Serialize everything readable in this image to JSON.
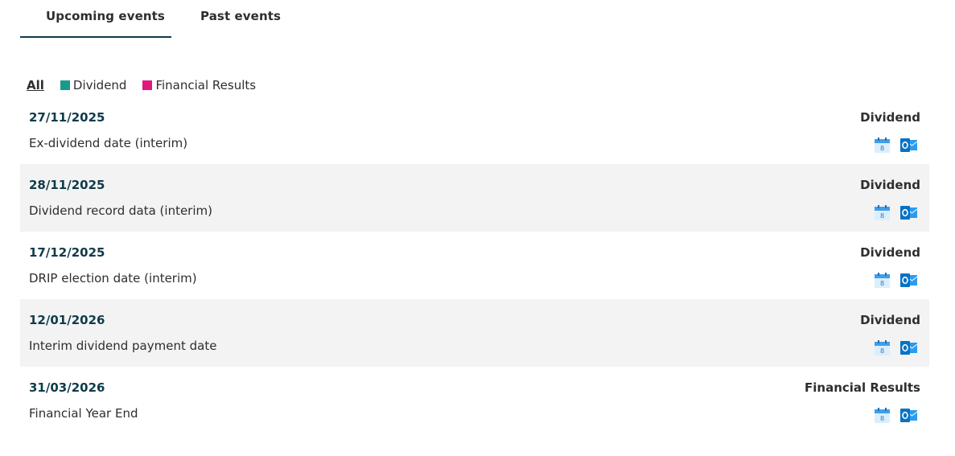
{
  "tabs": {
    "upcoming": "Upcoming events",
    "past": "Past events"
  },
  "filters": {
    "all": "All",
    "items": [
      {
        "label": "Dividend",
        "color": "#1a9a8a"
      },
      {
        "label": "Financial Results",
        "color": "#e0197d"
      }
    ]
  },
  "events": [
    {
      "date": "27/11/2025",
      "title": "Ex-dividend date (interim)",
      "category": "Dividend"
    },
    {
      "date": "28/11/2025",
      "title": "Dividend record data (interim)",
      "category": "Dividend"
    },
    {
      "date": "17/12/2025",
      "title": "DRIP election date (interim)",
      "category": "Dividend"
    },
    {
      "date": "12/01/2026",
      "title": "Interim dividend payment date",
      "category": "Dividend"
    },
    {
      "date": "31/03/2026",
      "title": "Financial Year End",
      "category": "Financial Results"
    }
  ],
  "icons": {
    "calendar": "ical-calendar-icon",
    "outlook": "outlook-icon"
  },
  "colors": {
    "accent": "#0f3b4a",
    "row_shade": "#f3f3f3",
    "calendar_blue": "#3f9fea",
    "outlook_blue": "#0a72c4"
  }
}
